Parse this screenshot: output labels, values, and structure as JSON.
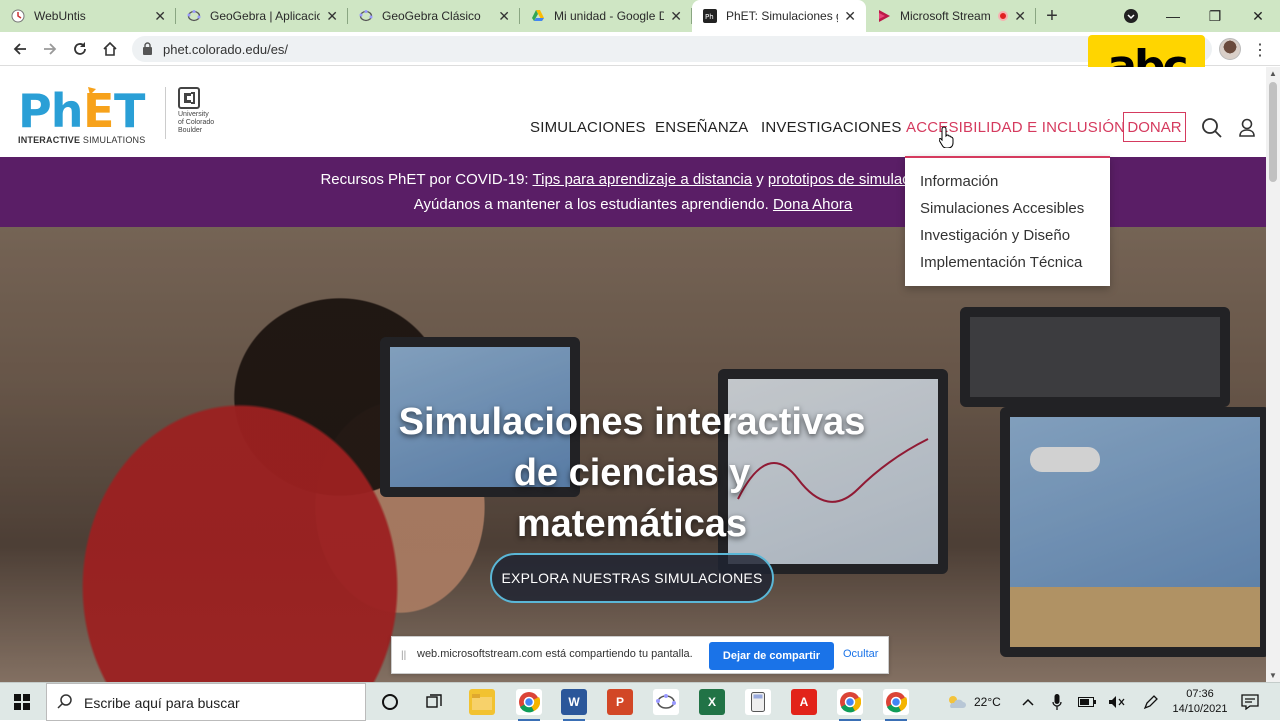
{
  "browser": {
    "tabs": [
      {
        "title": "WebUntis",
        "icon": "clock-icon"
      },
      {
        "title": "GeoGebra | Aplicaciones",
        "icon": "geogebra-icon"
      },
      {
        "title": "GeoGebra Clásico",
        "icon": "geogebra-icon"
      },
      {
        "title": "Mi unidad - Google Drive",
        "icon": "google-drive-icon"
      },
      {
        "title": "PhET: Simulaciones gratuitas",
        "icon": "phet-icon",
        "active": true
      },
      {
        "title": "Microsoft Stream",
        "icon": "stream-icon",
        "recording": true
      }
    ],
    "new_tab_symbol": "+",
    "url": "phet.colorado.edu/es/"
  },
  "overlay_logo": "abc",
  "site": {
    "logo_main": "PhET",
    "logo_sub_bold": "INTERACTIVE",
    "logo_sub_thin": "SIMULATIONS",
    "university": [
      "University",
      "of Colorado",
      "Boulder"
    ],
    "nav": {
      "simulaciones": "SIMULACIONES",
      "ensenanza": "ENSEÑANZA",
      "investigaciones": "INVESTIGACIONES",
      "accesibilidad": "ACCESIBILIDAD E INCLUSIÓN",
      "donar": "DONAR"
    },
    "dropdown": [
      "Información",
      "Simulaciones Accesibles",
      "Investigación y Diseño",
      "Implementación Técnica"
    ],
    "banner": {
      "l1_prefix": "Recursos PhET por COVID-19: ",
      "l1_link1": "Tips para aprendizaje a distancia",
      "l1_mid": " y ",
      "l1_link2": "prototipos de simulaciones",
      "l2_prefix": "Ayúdanos a mantener a los estudiantes aprendiendo. ",
      "l2_link": "Dona Ahora"
    },
    "hero": {
      "title_line1": "Simulaciones interactivas",
      "title_line2": "de ciencias y",
      "title_line3": "matemáticas",
      "cta": "EXPLORA NUESTRAS SIMULACIONES"
    },
    "colors": {
      "accent": "#d53a5e",
      "banner": "#5a1e66",
      "logo_blue": "#2a9fd6",
      "logo_orange": "#f7a21b"
    }
  },
  "share_bar": {
    "grip": "||",
    "message": "web.microsoftstream.com está compartiendo tu pantalla.",
    "stop": "Dejar de compartir",
    "hide": "Ocultar"
  },
  "taskbar": {
    "search_placeholder": "Escribe aquí para buscar",
    "temperature": "22°C",
    "time": "07:36",
    "date": "14/10/2021"
  }
}
